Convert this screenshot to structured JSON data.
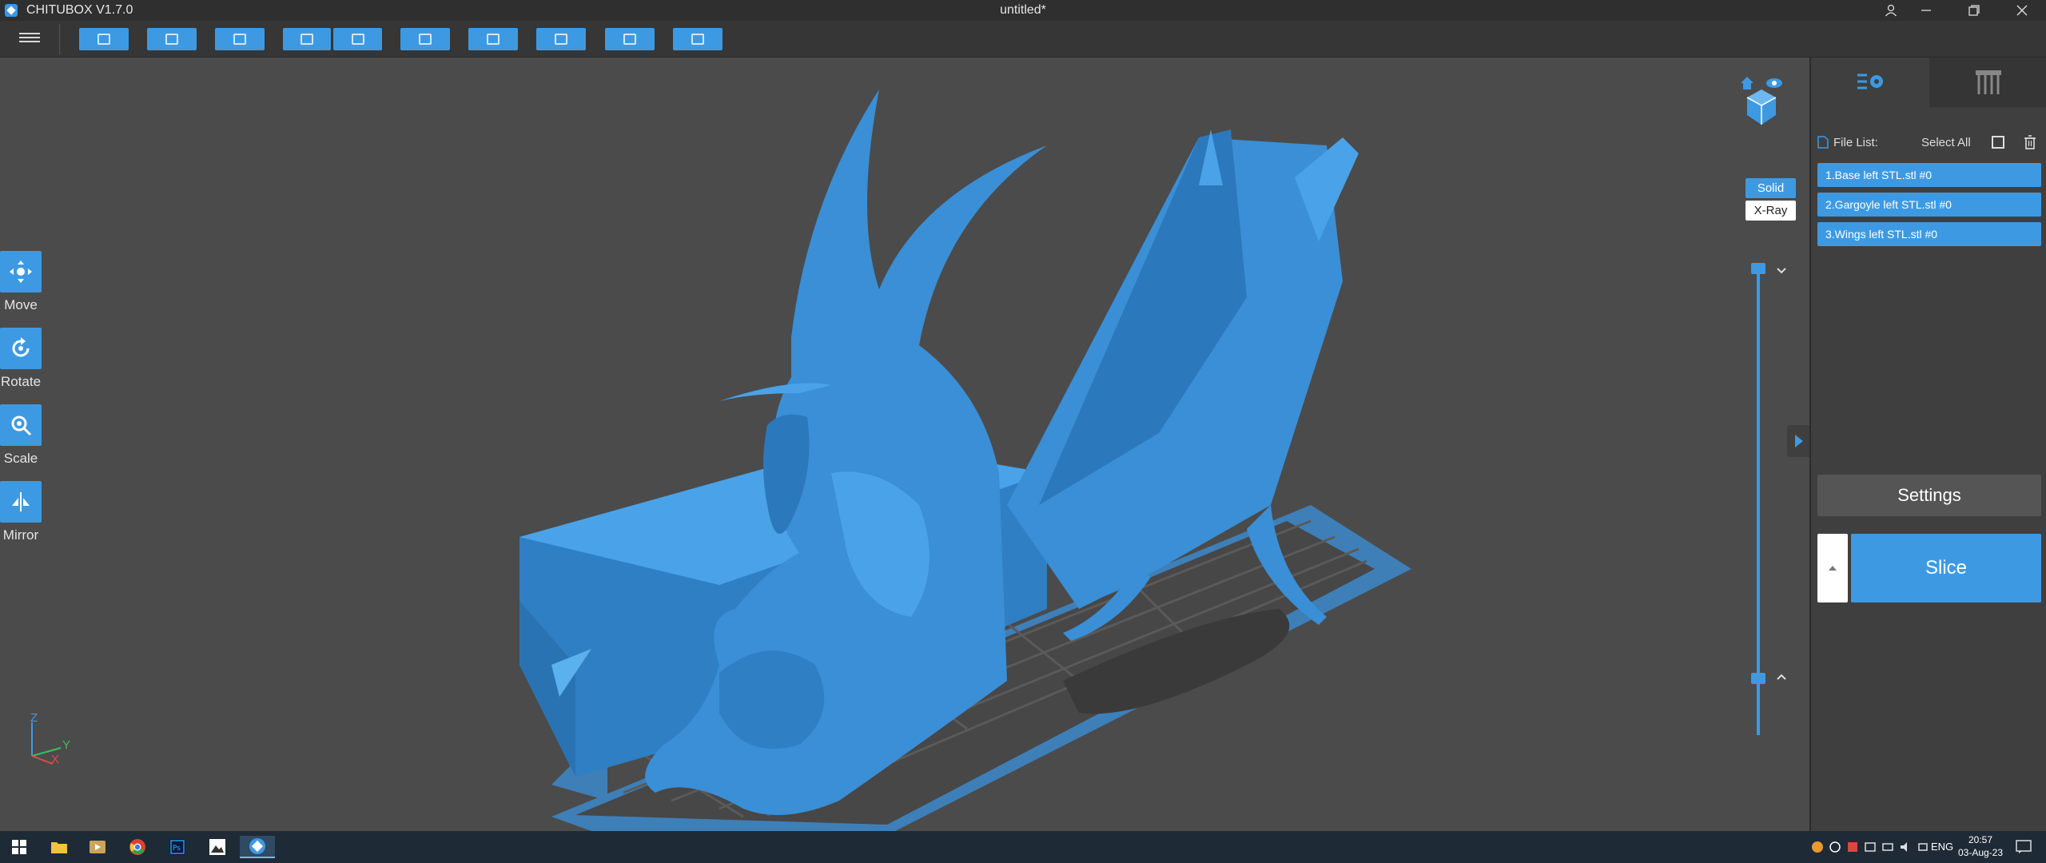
{
  "window": {
    "app_name": "CHITUBOX V1.7.0",
    "document_title": "untitled*"
  },
  "toolbar": {
    "buttons": [
      "open-file",
      "save",
      "auto-layout",
      "import-left",
      "export-right",
      "copy",
      "hollow",
      "dig-hole",
      "supports",
      "package"
    ]
  },
  "tools": [
    {
      "label": "Move",
      "icon": "move-arrows-icon"
    },
    {
      "label": "Rotate",
      "icon": "rotate-icon"
    },
    {
      "label": "Scale",
      "icon": "scale-icon"
    },
    {
      "label": "Mirror",
      "icon": "mirror-icon"
    }
  ],
  "view": {
    "solid_label": "Solid",
    "xray_label": "X-Ray",
    "axis": {
      "z": "Z",
      "y": "Y",
      "x": "X"
    }
  },
  "panel": {
    "file_list_label": "File List:",
    "select_all_label": "Select All",
    "files": [
      "1.Base left STL.stl #0",
      "2.Gargoyle left STL.stl #0",
      "3.Wings left STL.stl #0"
    ],
    "settings_label": "Settings",
    "slice_label": "Slice"
  },
  "taskbar": {
    "language": "ENG",
    "time": "20:57",
    "date": "03-Aug-23"
  },
  "colors": {
    "accent": "#3d9ae2",
    "model": "#3a8fd6",
    "background": "#4b4b4b"
  }
}
